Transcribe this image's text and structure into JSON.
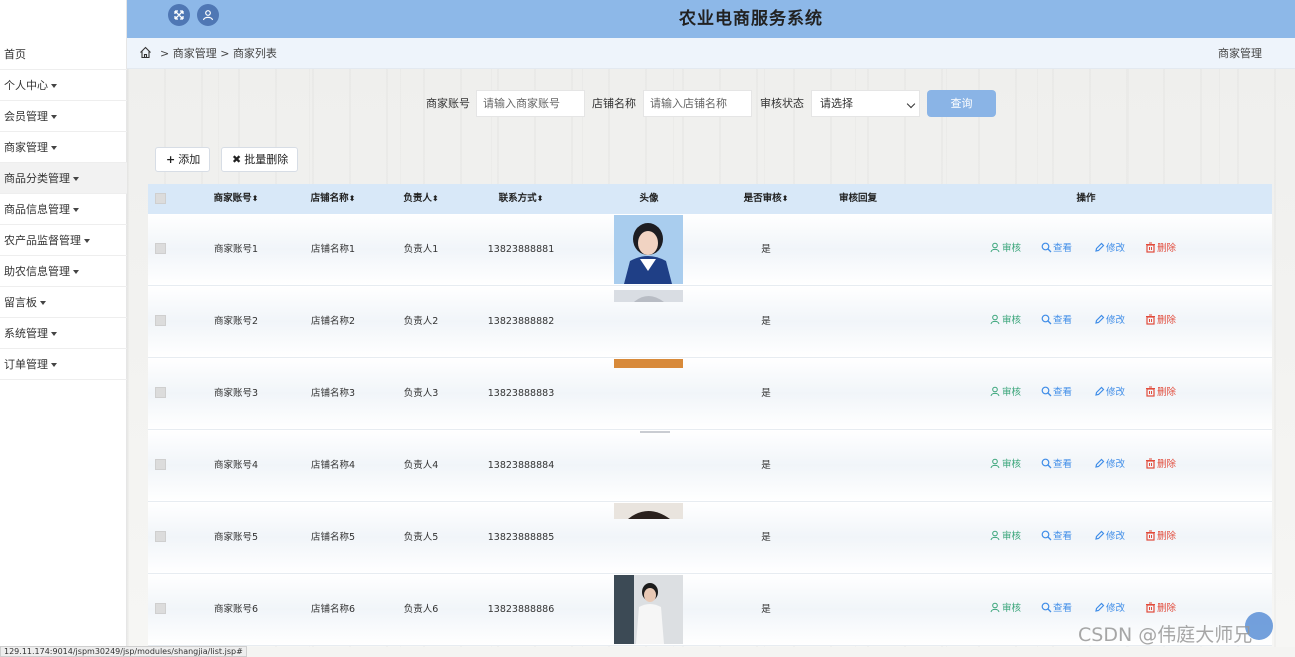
{
  "header": {
    "title": "农业电商服务系统",
    "fullscreen_icon": "expand-icon",
    "user_icon": "user-icon"
  },
  "sidebar": {
    "items": [
      {
        "label": "首页",
        "has_caret": false
      },
      {
        "label": "个人中心",
        "has_caret": true
      },
      {
        "label": "会员管理",
        "has_caret": true
      },
      {
        "label": "商家管理",
        "has_caret": true
      },
      {
        "label": "商品分类管理",
        "has_caret": true
      },
      {
        "label": "商品信息管理",
        "has_caret": true
      },
      {
        "label": "农产品监督管理",
        "has_caret": true
      },
      {
        "label": "助农信息管理",
        "has_caret": true
      },
      {
        "label": "留言板",
        "has_caret": true
      },
      {
        "label": "系统管理",
        "has_caret": true
      },
      {
        "label": "订单管理",
        "has_caret": true
      }
    ]
  },
  "breadcrumb": {
    "items": [
      "商家管理",
      "商家列表"
    ],
    "right_label": "商家管理"
  },
  "search": {
    "account_label": "商家账号",
    "account_placeholder": "请输入商家账号",
    "shop_label": "店铺名称",
    "shop_placeholder": "请输入店铺名称",
    "status_label": "审核状态",
    "status_value": "请选择",
    "query_button": "查询"
  },
  "toolbar": {
    "add_label": "添加",
    "batch_delete_label": "批量删除"
  },
  "table": {
    "headers": {
      "account": "商家账号",
      "shop": "店铺名称",
      "owner": "负责人",
      "phone": "联系方式",
      "avatar": "头像",
      "audited": "是否审核",
      "reply": "审核回复",
      "ops": "操作"
    },
    "actions": {
      "audit": "审核",
      "view": "查看",
      "edit": "修改",
      "delete": "删除"
    },
    "rows": [
      {
        "account": "商家账号1",
        "shop": "店铺名称1",
        "owner": "负责人1",
        "phone": "13823888881",
        "audited": "是",
        "reply": ""
      },
      {
        "account": "商家账号2",
        "shop": "店铺名称2",
        "owner": "负责人2",
        "phone": "13823888882",
        "audited": "是",
        "reply": ""
      },
      {
        "account": "商家账号3",
        "shop": "店铺名称3",
        "owner": "负责人3",
        "phone": "13823888883",
        "audited": "是",
        "reply": ""
      },
      {
        "account": "商家账号4",
        "shop": "店铺名称4",
        "owner": "负责人4",
        "phone": "13823888884",
        "audited": "是",
        "reply": ""
      },
      {
        "account": "商家账号5",
        "shop": "店铺名称5",
        "owner": "负责人5",
        "phone": "13823888885",
        "audited": "是",
        "reply": ""
      },
      {
        "account": "商家账号6",
        "shop": "店铺名称6",
        "owner": "负责人6",
        "phone": "13823888886",
        "audited": "是",
        "reply": ""
      }
    ]
  },
  "statusbar": {
    "url": "129.11.174:9014/jspm30249/jsp/modules/shangjia/list.jsp#"
  },
  "watermark": "CSDN @伟庭大师兄",
  "colors": {
    "header_bg": "#8db8e8",
    "query_button": "#8ab4e6",
    "audit": "#3aa57a",
    "view_edit": "#3f8de8",
    "delete": "#e24b3b"
  }
}
